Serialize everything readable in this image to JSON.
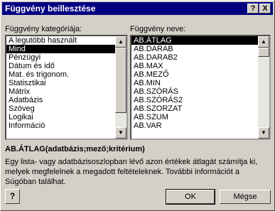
{
  "dialog": {
    "title": "Függvény beillesztése",
    "help_glyph": "?",
    "close_glyph": "X"
  },
  "category": {
    "label": "Függvény kategóriája:",
    "items": [
      "A legutóbb használt",
      "Mind",
      "Pénzügyi",
      "Dátum és idő",
      "Mat. és trigonom.",
      "Statisztikai",
      "Mátrix",
      "Adatbázis",
      "Szöveg",
      "Logikai",
      "Információ"
    ],
    "selected": "Mind"
  },
  "function": {
    "label": "Függvény neve:",
    "items": [
      "AB.ÁTLAG",
      "AB.DARAB",
      "AB.DARAB2",
      "AB.MAX",
      "AB.MEZŐ",
      "AB.MIN",
      "AB.SZÓRÁS",
      "AB.SZÓRÁS2",
      "AB.SZORZAT",
      "AB.SZUM",
      "AB.VAR"
    ],
    "selected": "AB.ÁTLAG"
  },
  "syntax": "AB.ÁTLAG(adatbázis;mező;kritérium)",
  "description": "Egy lista- vagy adatbázisoszlopban lévő azon értékek átlagát számítja ki, melyek megfelelnek a megadott feltételeknek. További információt a Súgóban találhat.",
  "buttons": {
    "ok": "OK",
    "cancel": "Mégse"
  },
  "scroll": {
    "up": "▲",
    "down": "▼"
  }
}
